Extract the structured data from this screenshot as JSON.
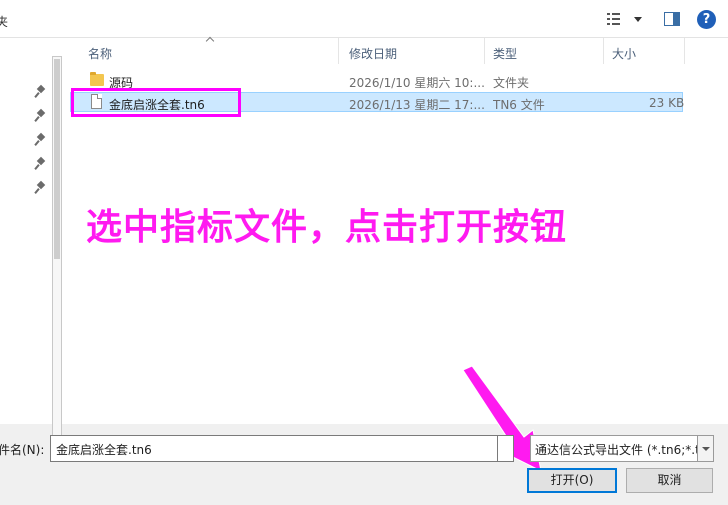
{
  "toolbar": {
    "cut_label": "夹",
    "view_icon": "view-options-icon",
    "dropdown_icon": "chevron-down-icon",
    "pane_icon": "preview-pane-icon",
    "help_label": "?"
  },
  "file_list": {
    "columns": {
      "name": "名称",
      "modified": "修改日期",
      "type": "类型",
      "size": "大小"
    },
    "rows": [
      {
        "name": "源码",
        "modified": "2026/1/10 星期六 10:...",
        "type": "文件夹",
        "size": "",
        "icon": "folder-icon",
        "selected": false
      },
      {
        "name": "金底启涨全套.tn6",
        "modified": "2026/1/13 星期二 17:...",
        "type": "TN6 文件",
        "size": "23 KB",
        "icon": "document-icon",
        "selected": true
      }
    ]
  },
  "annotation": {
    "text": "选中指标文件，点击打开按钮",
    "color": "#ff1af0"
  },
  "footer": {
    "filename_label": "件名(N):",
    "filename_value": "金底启涨全套.tn6",
    "filetype_value": "通达信公式导出文件 (*.tn6;*.tn",
    "open_button": "打开(O)",
    "cancel_button": "取消"
  },
  "colors": {
    "selection": "#cce8ff",
    "highlight": "#ff00ff",
    "accent": "#0078d7"
  }
}
